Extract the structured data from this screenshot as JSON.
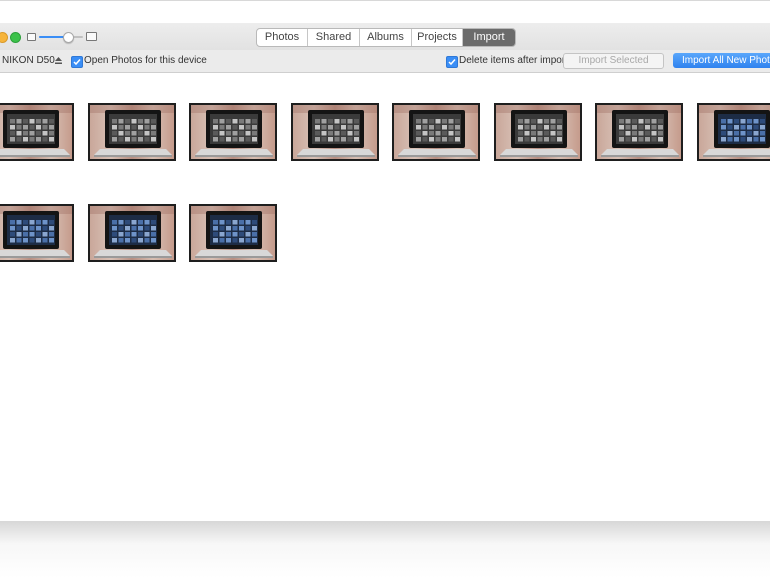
{
  "toolbar": {
    "tabs": [
      {
        "label": "Photos",
        "active": false
      },
      {
        "label": "Shared",
        "active": false
      },
      {
        "label": "Albums",
        "active": false
      },
      {
        "label": "Projects",
        "active": false
      },
      {
        "label": "Import",
        "active": true
      }
    ],
    "thumbnail_size_slider": {
      "value": 0.65
    }
  },
  "import_bar": {
    "device_name": "NIKON D50",
    "open_photos_label": "Open Photos for this device",
    "open_photos_checked": true,
    "delete_after_import_label": "Delete items after import",
    "delete_after_import_checked": true,
    "import_selected_label": "Import Selected",
    "import_all_label": "Import All New Photos"
  },
  "photos": [
    {
      "screen": "grey"
    },
    {
      "screen": "grey"
    },
    {
      "screen": "grey"
    },
    {
      "screen": "grey"
    },
    {
      "screen": "grey"
    },
    {
      "screen": "grey"
    },
    {
      "screen": "grey"
    },
    {
      "screen": "blue"
    },
    {
      "screen": "blue"
    },
    {
      "screen": "blue"
    },
    {
      "screen": "blue"
    }
  ],
  "colors": {
    "accent": "#3a8ef6",
    "active_tab": "#6b6b6b",
    "thumb_border": "#1e1e1e"
  }
}
